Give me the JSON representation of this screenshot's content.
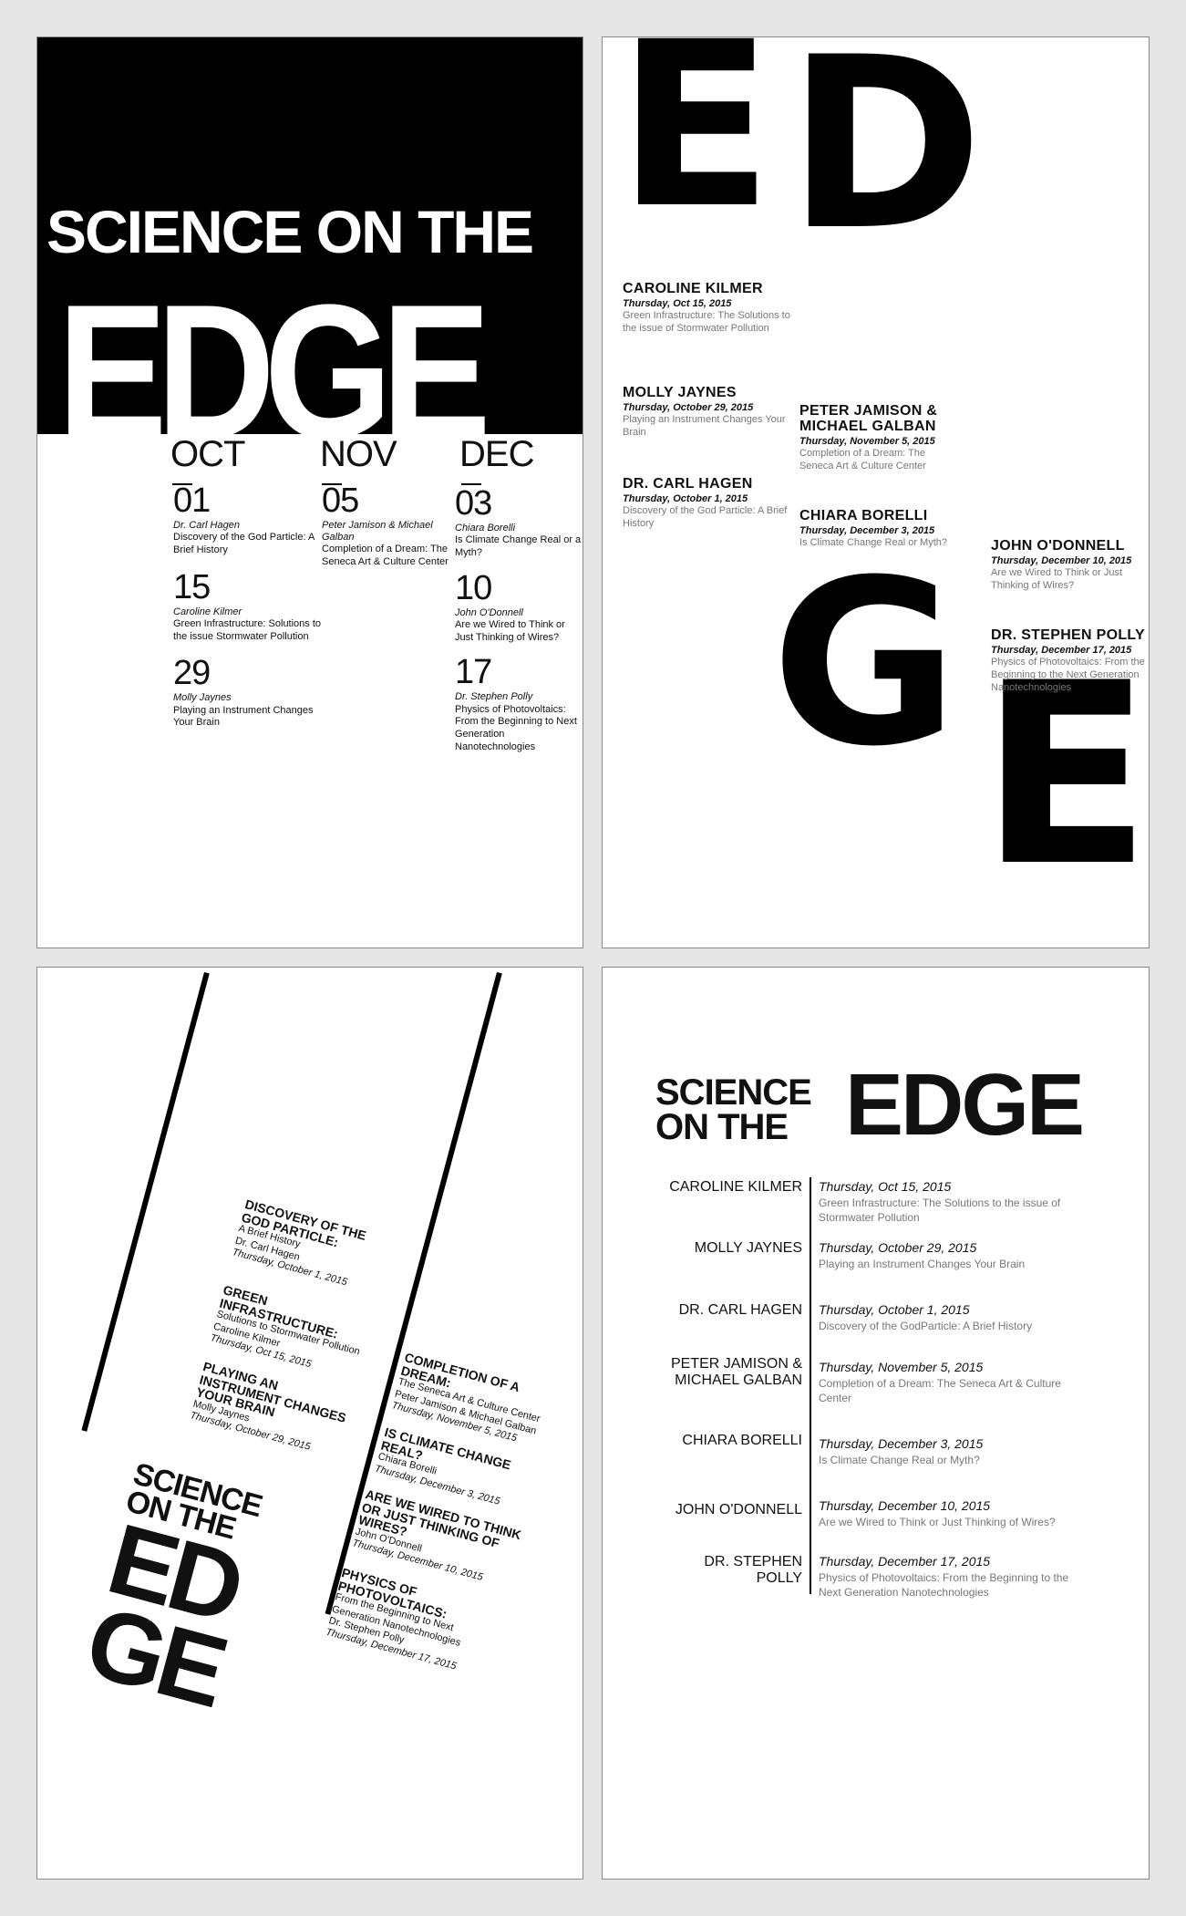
{
  "poster1": {
    "title": "SCIENCE ON THE",
    "edge": "EDGE",
    "months": [
      "OCT",
      "NOV",
      "DEC"
    ],
    "oct": [
      {
        "day": "01",
        "name": "Dr. Carl Hagen",
        "desc": "Discovery of the God Particle: A Brief History"
      },
      {
        "day": "15",
        "name": "Caroline Kilmer",
        "desc": "Green Infrastructure: Solutions to the issue Stormwater Pollution"
      },
      {
        "day": "29",
        "name": "Molly Jaynes",
        "desc": "Playing an Instrument Changes Your Brain"
      }
    ],
    "nov": [
      {
        "day": "05",
        "name": "Peter Jamison & Michael Galban",
        "desc": "Completion of a Dream: The Seneca Art & Culture Center"
      }
    ],
    "dec": [
      {
        "day": "03",
        "name": "Chiara Borelli",
        "desc": "Is Climate Change Real or a Myth?"
      },
      {
        "day": "10",
        "name": "John O'Donnell",
        "desc": "Are we Wired to Think or Just Thinking of Wires?"
      },
      {
        "day": "17",
        "name": "Dr. Stephen Polly",
        "desc": "Physics of Photovoltaics: From the Beginning to Next Generation Nanotechnologies"
      }
    ]
  },
  "poster2": {
    "letters": [
      "E",
      "D",
      "G",
      "E"
    ],
    "events": [
      {
        "name": "CAROLINE KILMER",
        "date": "Thursday, Oct 15, 2015",
        "desc": "Green Infrastructure: The Solutions to the issue of Stormwater Pollution"
      },
      {
        "name": "MOLLY JAYNES",
        "date": "Thursday, October 29, 2015",
        "desc": "Playing an Instrument Changes Your Brain"
      },
      {
        "name": "DR. CARL HAGEN",
        "date": "Thursday, October 1, 2015",
        "desc": "Discovery of the God Particle: A Brief History"
      },
      {
        "name": "PETER JAMISON & MICHAEL GALBAN",
        "date": "Thursday, November 5, 2015",
        "desc": "Completion of a Dream: The Seneca Art & Culture Center"
      },
      {
        "name": "CHIARA BORELLI",
        "date": "Thursday, December 3, 2015",
        "desc": "Is Climate Change Real or Myth?"
      },
      {
        "name": "JOHN O'DONNELL",
        "date": "Thursday, December 10, 2015",
        "desc": "Are we Wired to Think or Just Thinking of Wires?"
      },
      {
        "name": "DR. STEPHEN POLLY",
        "date": "Thursday, December 17, 2015",
        "desc": "Physics of Photovoltaics: From the Beginning to the Next Generation Nanotechnologies"
      }
    ]
  },
  "poster3": {
    "science": "SCIENCE",
    "on_the": "ON THE",
    "ed": "ED",
    "ge": "GE",
    "left_events": [
      {
        "title": "DISCOVERY OF THE GOD PARTICLE:",
        "sub": "A Brief History",
        "name": "Dr. Carl Hagen",
        "date": "Thursday, October 1, 2015"
      },
      {
        "title": "GREEN INFRASTRUCTURE:",
        "sub": "Solutions to Stormwater Pollution",
        "name": "Caroline Kilmer",
        "date": "Thursday, Oct 15, 2015"
      },
      {
        "title": "PLAYING AN INSTRUMENT CHANGES YOUR BRAIN",
        "sub": "",
        "name": "Molly Jaynes",
        "date": "Thursday, October 29, 2015"
      }
    ],
    "right_events": [
      {
        "title": "COMPLETION OF A DREAM:",
        "sub": "The Seneca Art & Culture Center",
        "name": "Peter Jamison & Michael Galban",
        "date": "Thursday, November 5, 2015"
      },
      {
        "title": "IS CLIMATE CHANGE REAL?",
        "sub": "",
        "name": "Chiara Borelli",
        "date": "Thursday, December 3, 2015"
      },
      {
        "title": "ARE WE WIRED TO THINK OR JUST THINKING OF WIRES?",
        "sub": "",
        "name": "John O'Donnell",
        "date": "Thursday, December 10, 2015"
      },
      {
        "title": "PHYSICS OF PHOTOVOLTAICS:",
        "sub": "From the Beginning to Next Generation Nanotechnologies",
        "name": "Dr. Stephen Polly",
        "date": "Thursday, December 17, 2015"
      }
    ]
  },
  "poster4": {
    "science": "SCIENCE",
    "on_the": "ON THE",
    "edge": "EDGE",
    "rows": [
      {
        "name": "CAROLINE KILMER",
        "date": "Thursday, Oct 15, 2015",
        "desc": "Green Infrastructure: The Solutions to the issue of Stormwater Pollution"
      },
      {
        "name": "MOLLY JAYNES",
        "date": "Thursday, October 29, 2015",
        "desc": "Playing an Instrument Changes Your Brain"
      },
      {
        "name": "DR. CARL HAGEN",
        "date": "Thursday, October 1, 2015",
        "desc": "Discovery of the GodParticle: A Brief History"
      },
      {
        "name": "PETER JAMISON & MICHAEL GALBAN",
        "date": "Thursday, November 5, 2015",
        "desc": "Completion of a Dream: The Seneca Art & Culture Center"
      },
      {
        "name": "CHIARA BORELLI",
        "date": "Thursday, December 3, 2015",
        "desc": "Is Climate Change Real or Myth?"
      },
      {
        "name": "JOHN O'DONNELL",
        "date": "Thursday, December 10, 2015",
        "desc": "Are we Wired to Think or Just Thinking of Wires?"
      },
      {
        "name": "DR. STEPHEN POLLY",
        "date": "Thursday, December 17, 2015",
        "desc": "Physics of Photovoltaics: From the Beginning to the Next Generation Nanotechnologies"
      }
    ]
  }
}
